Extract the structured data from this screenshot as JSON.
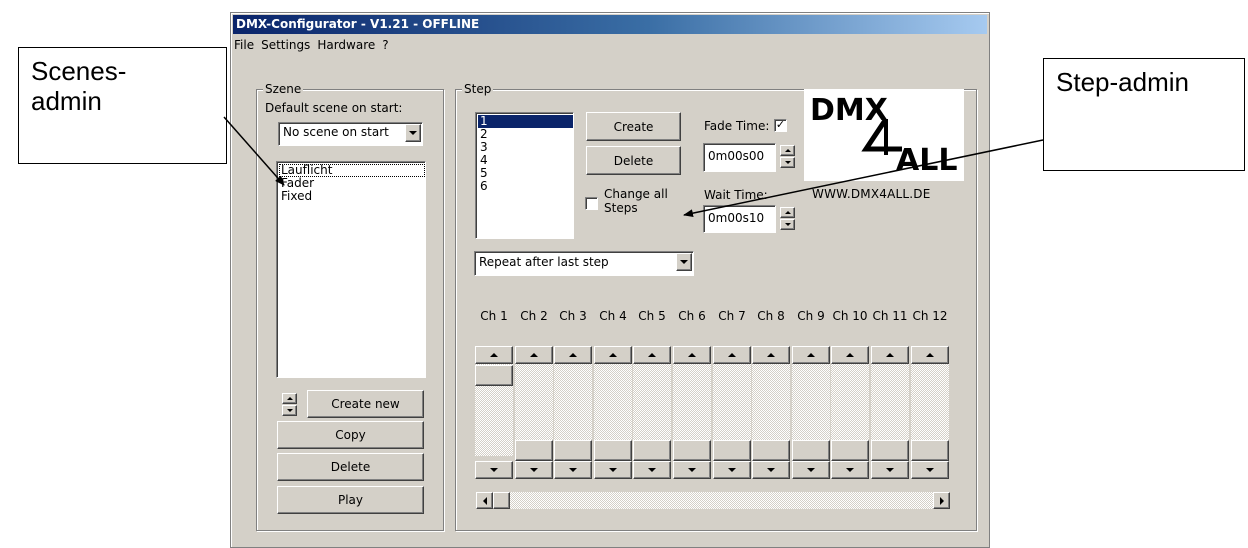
{
  "callouts": {
    "left": "Scenes-\nadmin",
    "right": "Step-admin"
  },
  "window": {
    "title": "DMX-Configurator - V1.21 - OFFLINE"
  },
  "menu": [
    "File",
    "Settings",
    "Hardware",
    "?"
  ],
  "scene_group": {
    "label": "Szene",
    "default_label": "Default scene on start:",
    "default_value": "No scene on start",
    "scenes": [
      "Lauflicht",
      "Fader",
      "Fixed"
    ],
    "buttons": {
      "create_new": "Create new",
      "copy": "Copy",
      "delete": "Delete",
      "play": "Play"
    }
  },
  "step_group": {
    "label": "Step",
    "steps": [
      "1",
      "2",
      "3",
      "4",
      "5",
      "6"
    ],
    "selected_step": "1",
    "create_label": "Create",
    "delete_label": "Delete",
    "change_all_label": "Change all\nSteps",
    "change_all_checked": false,
    "fade_time_label": "Fade Time:",
    "fade_time_checked": true,
    "fade_time_value": "0m00s00",
    "wait_time_label": "Wait Time:",
    "wait_time_value": "0m00s10",
    "repeat_value": "Repeat after last step",
    "channels": [
      "Ch 1",
      "Ch 2",
      "Ch 3",
      "Ch 4",
      "Ch 5",
      "Ch 6",
      "Ch 7",
      "Ch 8",
      "Ch 9",
      "Ch 10",
      "Ch 11",
      "Ch 12"
    ],
    "channel_levels": [
      1,
      0,
      0,
      0,
      0,
      0,
      0,
      0,
      0,
      0,
      0,
      0
    ]
  },
  "logo": {
    "line1": "DMX",
    "line2": "ALL",
    "url": "WWW.DMX4ALL.DE"
  }
}
